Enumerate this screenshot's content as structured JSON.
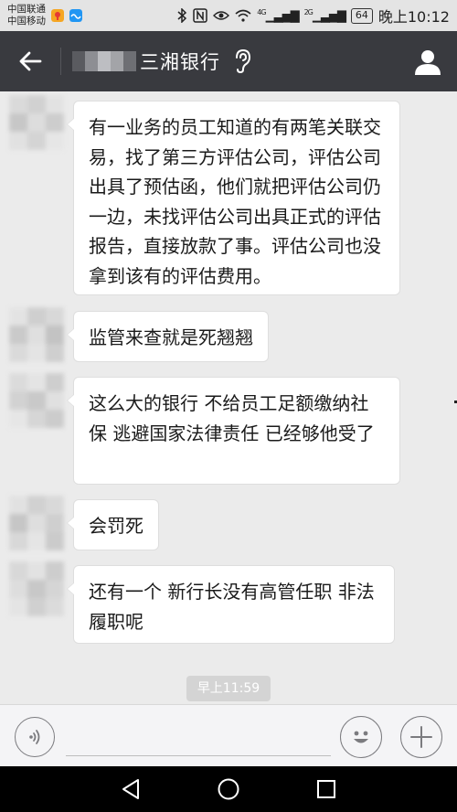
{
  "status_bar": {
    "carrier_1": "中国联通",
    "carrier_2": "中国移动",
    "network_1": "4G",
    "network_2": "2G",
    "battery": "64",
    "time": "晚上10:12"
  },
  "header": {
    "title": "三湘银行",
    "title_masked": true,
    "back_icon": "arrow-left-icon",
    "ear_icon": "ear-icon",
    "profile_icon": "person-icon",
    "background_color": "#393a3f"
  },
  "messages": [
    {
      "text": "有一业务的员工知道的有两笔关联交易，找了第三方评估公司，评估公司出具了预估函，他们就把评估公司仍一边，未找评估公司出具正式的评估报告，直接放款了事。评估公司也没拿到该有的评估费用。"
    },
    {
      "text": "监管来查就是死翘翘"
    },
    {
      "text": "这么大的银行 不给员工足额缴纳社保 逃避国家法律责任 已经够他受了"
    },
    {
      "text": "会罚死"
    },
    {
      "text": "还有一个 新行长没有高管任职 非法履职呢"
    }
  ],
  "timestamp": "早上11:59",
  "input_bar": {
    "placeholder": "",
    "voice_icon": "voice-icon",
    "emoji_icon": "smiley-icon",
    "plus_icon": "plus-icon"
  },
  "nav_bar": {
    "back_icon": "triangle-back-icon",
    "home_icon": "circle-home-icon",
    "recents_icon": "square-recents-icon"
  },
  "colors": {
    "chat_background": "#ebebeb",
    "bubble_background": "#ffffff",
    "title_bar": "#393a3f",
    "nav_bar": "#000000"
  }
}
